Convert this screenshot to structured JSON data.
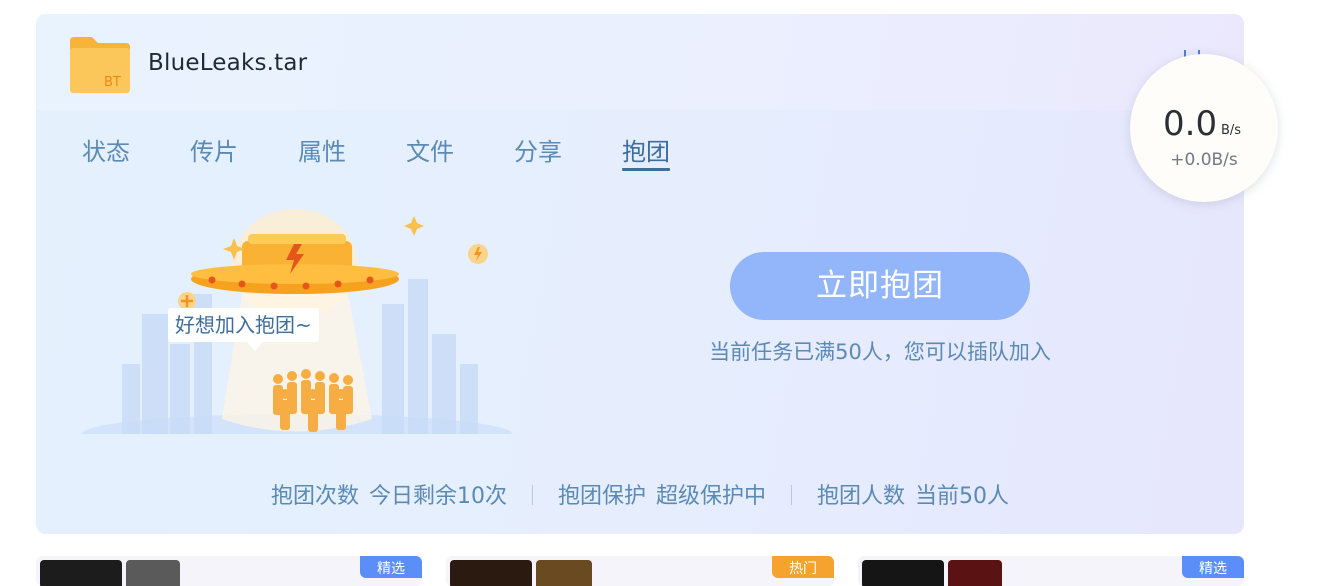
{
  "task": {
    "file_name": "BlueLeaks.tar",
    "file_icon": "bt-folder-icon",
    "folder_badge": "BT"
  },
  "tabs": [
    {
      "label": "状态",
      "active": false
    },
    {
      "label": "传片",
      "active": false
    },
    {
      "label": "属性",
      "active": false
    },
    {
      "label": "文件",
      "active": false
    },
    {
      "label": "分享",
      "active": false
    },
    {
      "label": "抱团",
      "active": true
    }
  ],
  "illustration": {
    "bubble_text": "好想加入抱团~",
    "icon": "ufo-group-illustration"
  },
  "join": {
    "button_label": "立即抱团",
    "hint": "当前任务已满50人，您可以插队加入"
  },
  "stats": [
    {
      "label": "抱团次数",
      "value": "今日剩余10次"
    },
    {
      "label": "抱团保护",
      "value": "超级保护中"
    },
    {
      "label": "抱团人数",
      "value": "当前50人"
    }
  ],
  "speed": {
    "value": "0.0",
    "unit": "B/s",
    "delta": "+0.0B/s"
  },
  "cards": [
    {
      "badge": "精选",
      "badge_color": "#5b8ef9"
    },
    {
      "badge": "热门",
      "badge_color": "#f5a22e"
    },
    {
      "badge": "精选",
      "badge_color": "#5b8ef9"
    }
  ],
  "colors": {
    "accent": "#3c6e9e",
    "tab_text": "#5b8ab5",
    "button": "#93b6fb",
    "folder": "#fbbf4a"
  }
}
